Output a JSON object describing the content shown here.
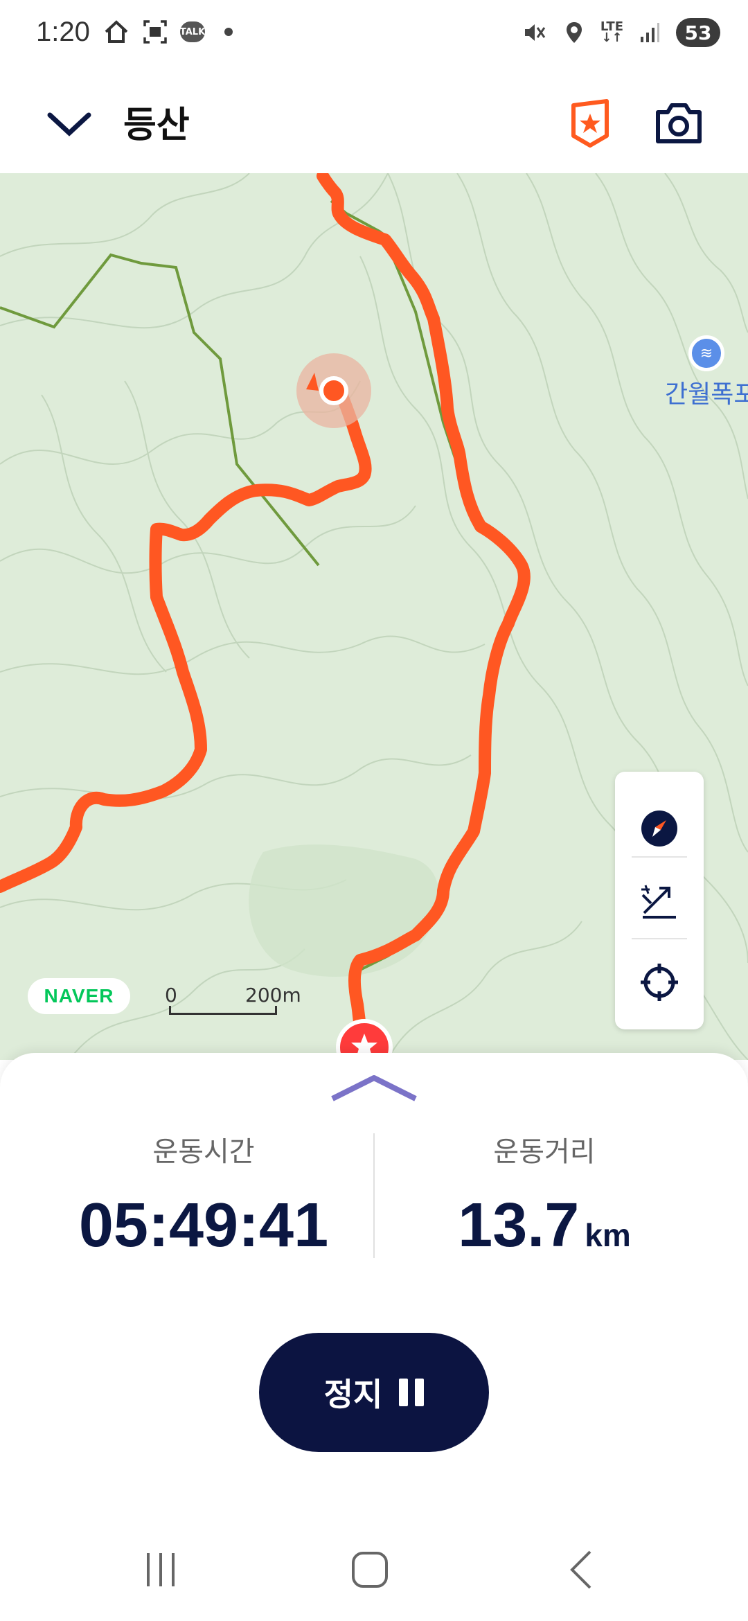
{
  "status_bar": {
    "time": "1:20",
    "lte_label": "LTE",
    "battery": "53",
    "talk_badge": "TALK"
  },
  "header": {
    "title": "등산"
  },
  "map": {
    "place_label": "간월폭포",
    "provider": "NAVER",
    "scale_zero": "0",
    "scale_distance": "200m",
    "accent_color": "#ff5722",
    "trail_color": "#6f9a3d"
  },
  "workout": {
    "time_label": "운동시간",
    "time_value": "05:49:41",
    "distance_label": "운동거리",
    "distance_value": "13.7",
    "distance_unit": "km",
    "stop_label": "정지"
  }
}
